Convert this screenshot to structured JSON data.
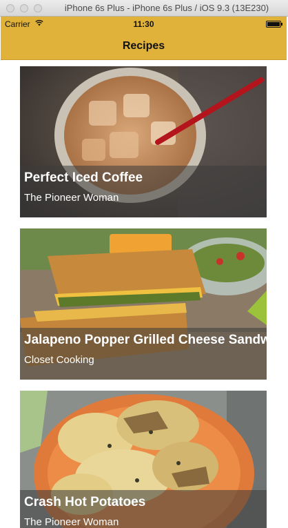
{
  "window": {
    "title": "iPhone 6s Plus - iPhone 6s Plus / iOS 9.3 (13E230)"
  },
  "status_bar": {
    "carrier": "Carrier",
    "time": "11:30"
  },
  "nav": {
    "title": "Recipes"
  },
  "colors": {
    "accent": "#e0b23a"
  },
  "recipes": [
    {
      "title": "Perfect Iced Coffee",
      "source": "The Pioneer Woman"
    },
    {
      "title": "Jalapeno Popper Grilled Cheese Sandwich",
      "source": "Closet Cooking"
    },
    {
      "title": "Crash Hot Potatoes",
      "source": "The Pioneer Woman"
    }
  ]
}
